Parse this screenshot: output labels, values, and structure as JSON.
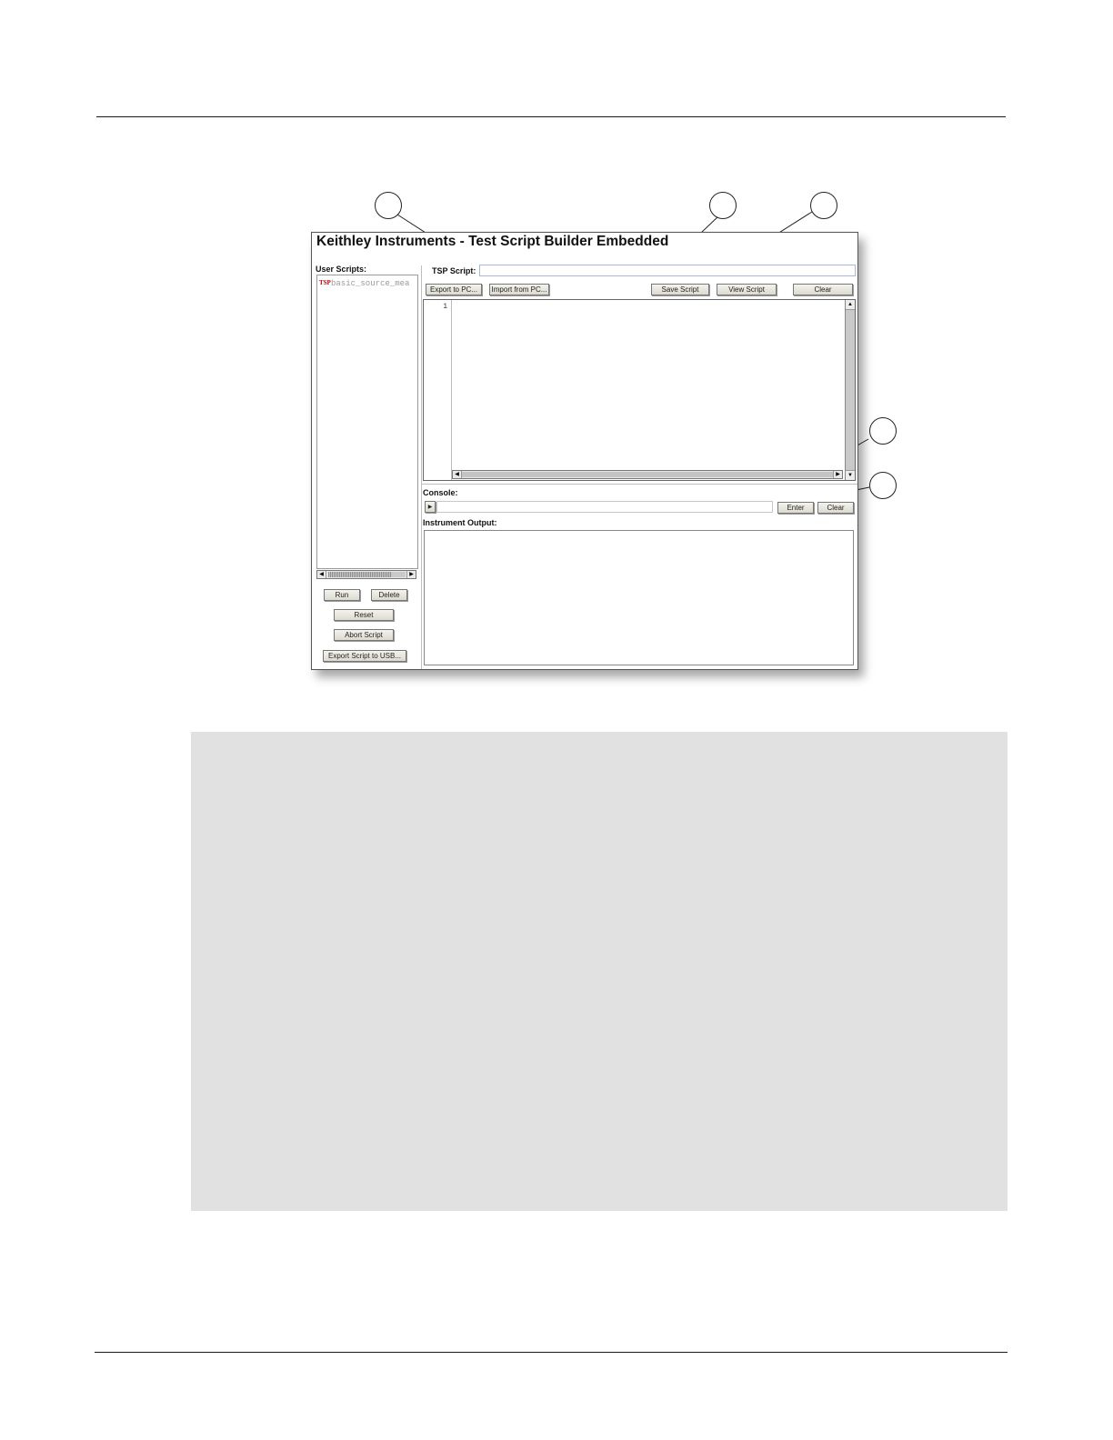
{
  "window": {
    "title": "Keithley Instruments - Test Script Builder Embedded",
    "user_scripts_label": "User Scripts:",
    "user_scripts": [
      "basic_source_mea"
    ],
    "tsp_script_label": "TSP Script:",
    "tsp_script_value": "",
    "buttons": {
      "export_pc": "Export to PC...",
      "import_pc": "Import from PC...",
      "save_script": "Save Script",
      "view_script": "View Script",
      "clear_editor": "Clear",
      "run": "Run",
      "delete": "Delete",
      "reset": "Reset",
      "abort": "Abort Script",
      "export_usb": "Export Script to USB...",
      "enter": "Enter",
      "clear_console": "Clear"
    },
    "editor": {
      "line_number": "1",
      "content": ""
    },
    "console_label": "Console:",
    "console_value": "",
    "output_label": "Instrument Output:",
    "output_value": ""
  },
  "icons": {
    "tsp_file": "TSP",
    "scroll_left": "◀",
    "scroll_right": "▶",
    "scroll_up": "▲",
    "scroll_down": "▼",
    "console_prompt": "▶"
  }
}
